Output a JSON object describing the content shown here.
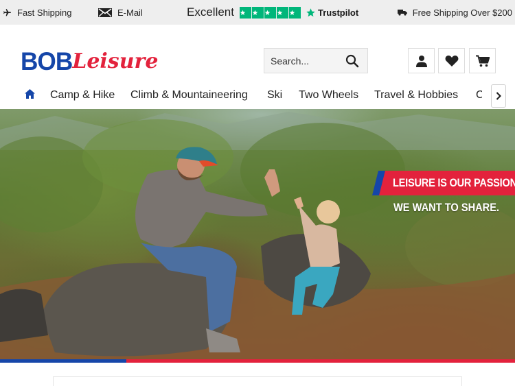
{
  "topbar": {
    "fast_shipping": "Fast Shipping",
    "email": "E-Mail",
    "trust_rating": "Excellent",
    "trust_stars": 5,
    "trust_brand": "Trustpilot",
    "free_shipping": "Free Shipping Over $200"
  },
  "header": {
    "logo_part1": "BOB",
    "logo_part2": "Leisure",
    "search_placeholder": "Search...",
    "icons": [
      "user-icon",
      "heart-icon",
      "cart-icon"
    ]
  },
  "nav": {
    "home_icon": "home-icon",
    "items": [
      "Camp & Hike",
      "Climb & Mountaineering",
      "Ski",
      "Two Wheels",
      "Travel & Hobbies",
      "C"
    ]
  },
  "hero": {
    "slogan_line1": "LEISURE IS OUR PASSION,",
    "slogan_line2": "WE WANT TO SHARE."
  },
  "colors": {
    "brand_blue": "#1546a9",
    "brand_red": "#e3223c",
    "trustpilot_green": "#00b67a"
  }
}
